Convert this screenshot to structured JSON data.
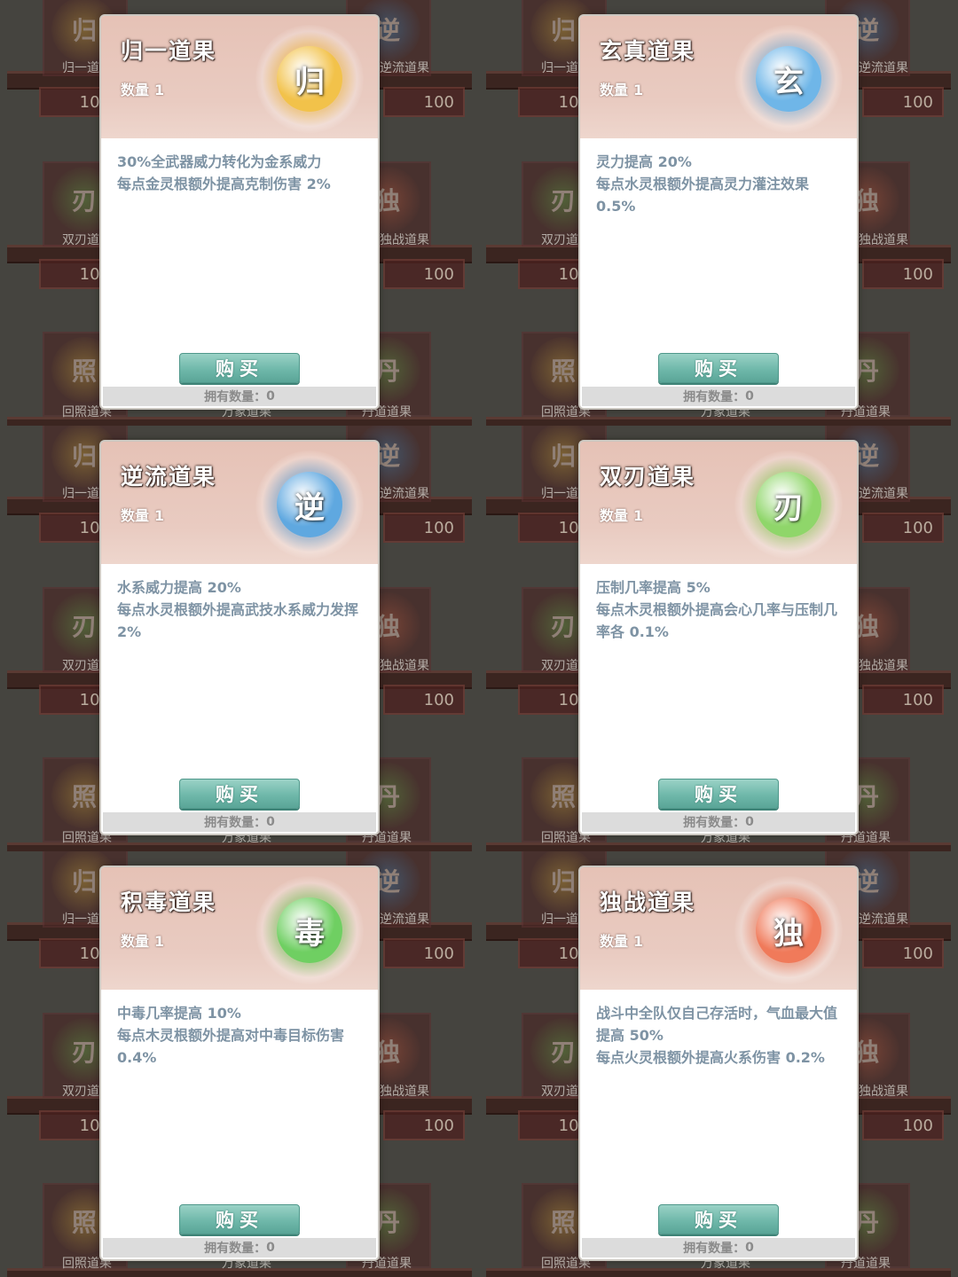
{
  "background": {
    "shelf_labels_row1": [
      "归一道果",
      "逆流道果"
    ],
    "shelf_labels_row2": [
      "双刃道果",
      "独战道果"
    ],
    "shelf_labels_row3": [
      "回照道果",
      "万象道果",
      "丹道道果"
    ],
    "price": "100",
    "orb_chars": [
      "归",
      "逆",
      "刃",
      "独",
      "照",
      "丹"
    ]
  },
  "cards": [
    {
      "title": "归一道果",
      "qty_label": "数量",
      "qty_value": "1",
      "emblem_char": "归",
      "emblem_color": "#f2c24a",
      "desc": [
        "30%全武器威力转化为金系威力",
        "每点金灵根额外提高克制伤害 2%"
      ],
      "buy_label": "购买",
      "owned_label": "拥有数量：",
      "owned_value": "0"
    },
    {
      "title": "玄真道果",
      "qty_label": "数量",
      "qty_value": "1",
      "emblem_char": "玄",
      "emblem_color": "#6fb6e8",
      "desc": [
        "灵力提高 20%",
        "每点水灵根额外提高灵力灌注效果 0.5%"
      ],
      "buy_label": "购买",
      "owned_label": "拥有数量：",
      "owned_value": "0"
    },
    {
      "title": "逆流道果",
      "qty_label": "数量",
      "qty_value": "1",
      "emblem_char": "逆",
      "emblem_color": "#5fa8e0",
      "desc": [
        "水系威力提高 20%",
        "每点水灵根额外提高武技水系威力发挥 2%"
      ],
      "buy_label": "购买",
      "owned_label": "拥有数量：",
      "owned_value": "0"
    },
    {
      "title": "双刃道果",
      "qty_label": "数量",
      "qty_value": "1",
      "emblem_char": "刃",
      "emblem_color": "#8fd66a",
      "desc": [
        "压制几率提高 5%",
        "每点木灵根额外提高会心几率与压制几率各 0.1%"
      ],
      "buy_label": "购买",
      "owned_label": "拥有数量：",
      "owned_value": "0"
    },
    {
      "title": "积毒道果",
      "qty_label": "数量",
      "qty_value": "1",
      "emblem_char": "毒",
      "emblem_color": "#6fcf62",
      "desc": [
        "中毒几率提高 10%",
        "每点木灵根额外提高对中毒目标伤害 0.4%"
      ],
      "buy_label": "购买",
      "owned_label": "拥有数量：",
      "owned_value": "0"
    },
    {
      "title": "独战道果",
      "qty_label": "数量",
      "qty_value": "1",
      "emblem_char": "独",
      "emblem_color": "#f07a5a",
      "desc": [
        "战斗中全队仅自己存活时，气血最大值提高 50%",
        "每点火灵根额外提高火系伤害 0.2%"
      ],
      "buy_label": "购买",
      "owned_label": "拥有数量：",
      "owned_value": "0"
    }
  ]
}
